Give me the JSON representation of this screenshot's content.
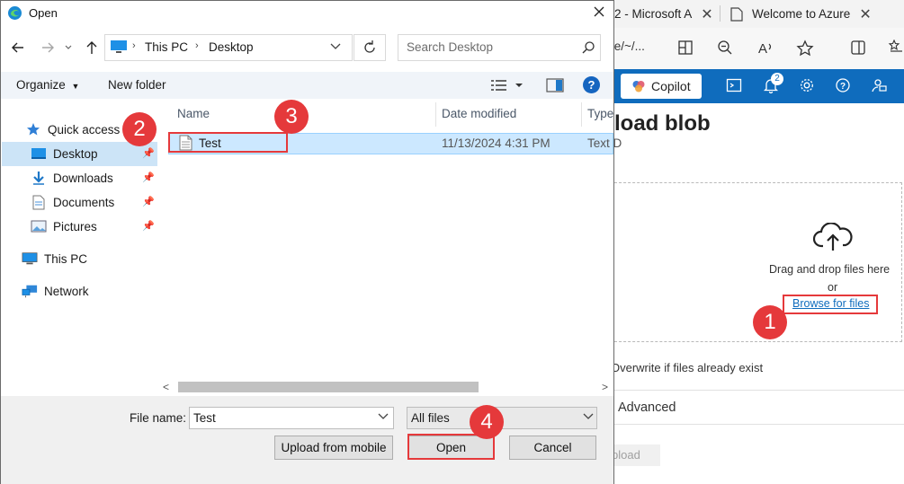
{
  "browser": {
    "tabs": [
      {
        "label": "2 - Microsoft A",
        "close": "✕"
      },
      {
        "label": "Welcome to Azure",
        "close": "✕"
      }
    ],
    "address_partial": "/e/~/...",
    "copilot_label": "Copilot",
    "notification_count": "2"
  },
  "azure": {
    "page_title": "load blob",
    "drag_text": "Drag and drop files here",
    "or_text": "or",
    "browse_link": "Browse for files",
    "overwrite_label": "Overwrite if files already exist",
    "advanced_label": "Advanced",
    "upload_button": "pload"
  },
  "dialog": {
    "title": "Open",
    "breadcrumb": [
      "This PC",
      "Desktop"
    ],
    "search_placeholder": "Search Desktop",
    "toolbar": {
      "organize": "Organize",
      "new_folder": "New folder",
      "help": "?"
    },
    "nav": {
      "quick_access": "Quick access",
      "items": [
        "Desktop",
        "Downloads",
        "Documents",
        "Pictures"
      ],
      "this_pc": "This PC",
      "network": "Network"
    },
    "columns": [
      "Name",
      "Date modified",
      "Type"
    ],
    "files": [
      {
        "name": "Test",
        "date_modified": "11/13/2024 4:31 PM",
        "type": "Text D"
      }
    ],
    "file_name_label": "File name:",
    "file_name_value": "Test",
    "file_type": "All files",
    "buttons": {
      "upload_mobile": "Upload from mobile",
      "open": "Open",
      "cancel": "Cancel"
    }
  },
  "annotations": [
    "1",
    "2",
    "3",
    "4"
  ],
  "colors": {
    "highlight": "#e5393b",
    "azure_blue": "#0f6cbd",
    "selection": "#cce8ff"
  }
}
